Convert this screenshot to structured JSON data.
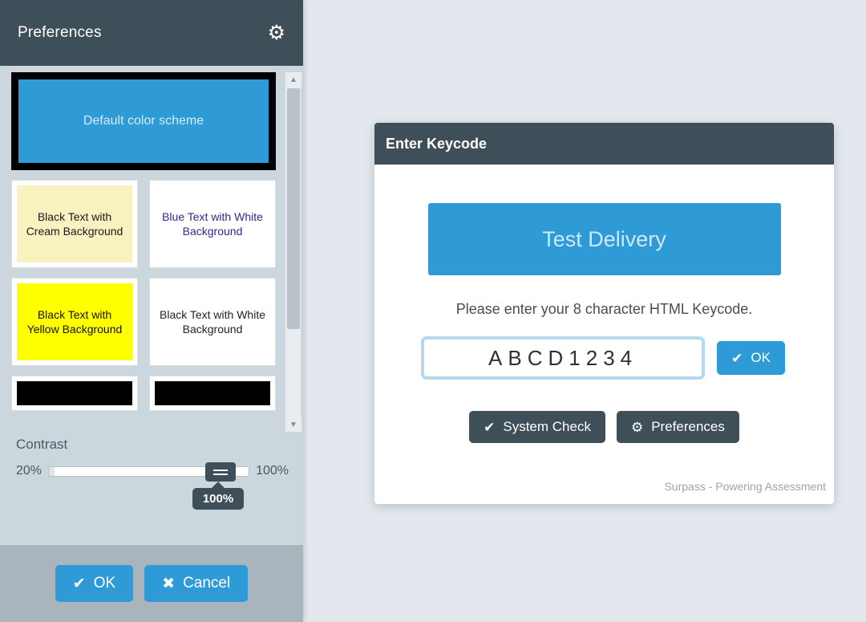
{
  "preferences_panel": {
    "title": "Preferences",
    "gear_icon": "gear-icon",
    "color_schemes": [
      {
        "label": "Default color scheme",
        "style": "swatch-default",
        "selected": true,
        "clipped": false,
        "full_width": true
      },
      {
        "label": "Black Text with Cream Background",
        "style": "swatch-cream",
        "selected": false,
        "clipped": false,
        "full_width": false
      },
      {
        "label": "Blue Text with White Background",
        "style": "swatch-bluewhite",
        "selected": false,
        "clipped": false,
        "full_width": false
      },
      {
        "label": "Black Text with Yellow Background",
        "style": "swatch-yellow",
        "selected": false,
        "clipped": false,
        "full_width": false
      },
      {
        "label": "Black Text with White Background",
        "style": "swatch-blackwhite",
        "selected": false,
        "clipped": false,
        "full_width": false
      },
      {
        "label": "",
        "style": "swatch-blackA",
        "selected": false,
        "clipped": true,
        "full_width": false
      },
      {
        "label": "",
        "style": "swatch-blackB",
        "selected": false,
        "clipped": true,
        "full_width": false
      }
    ],
    "contrast": {
      "label": "Contrast",
      "min_label": "20%",
      "max_label": "100%",
      "value_tooltip": "100%",
      "value": 100
    },
    "ok_button": "OK",
    "cancel_button": "Cancel",
    "ok_icon": "check-icon",
    "cancel_icon": "cross-icon",
    "scroll_up_icon": "chevron-up-icon",
    "scroll_down_icon": "chevron-down-icon"
  },
  "keycode_dialog": {
    "title": "Enter Keycode",
    "delivery_banner": "Test Delivery",
    "instruction": "Please enter your 8 character HTML Keycode.",
    "keycode_value": "ABCD1234",
    "keycode_placeholder": "",
    "ok_button": "OK",
    "ok_icon": "check-icon",
    "system_check_button": "System Check",
    "system_check_icon": "check-icon",
    "preferences_button": "Preferences",
    "preferences_icon": "gear-icon",
    "brand_footer": "Surpass - Powering Assessment"
  },
  "colors": {
    "accent_blue": "#2e9bd6",
    "header_dark": "#3e4f5a",
    "panel_body": "#ccd6dd",
    "panel_footer": "#a9b4bc",
    "page_background": "#e3e8ee",
    "cream": "#f7f2c0",
    "yellow": "#ffff00",
    "blue_text": "#2b2b8f"
  }
}
